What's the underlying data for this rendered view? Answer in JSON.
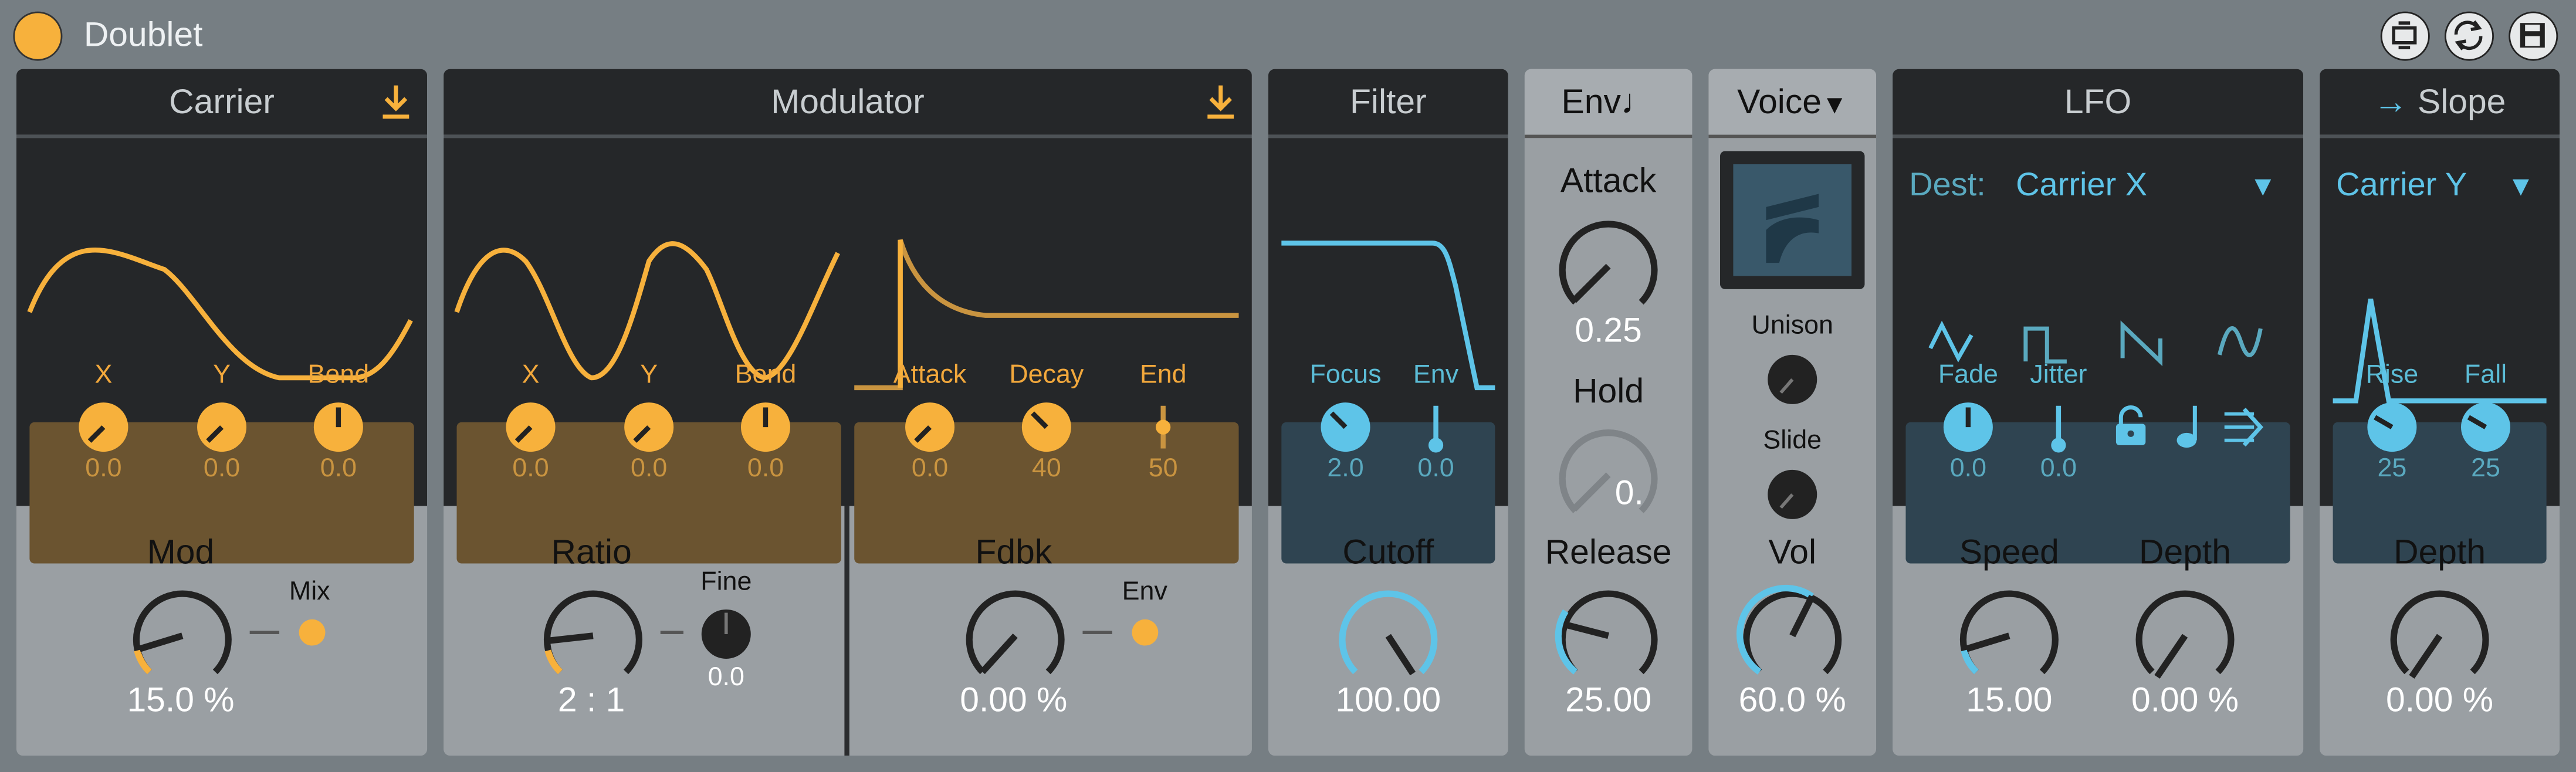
{
  "title": "Doublet",
  "colors": {
    "accent": "#f7b13c",
    "blue": "#5ec4e8",
    "panel": "#9a9fa3",
    "dark": "#252729",
    "frame": "#767e83"
  },
  "window_buttons": [
    "resize-icon",
    "refresh-icon",
    "save-icon"
  ],
  "carrier": {
    "title": "Carrier",
    "knobs": [
      {
        "label": "X",
        "value": "0.0"
      },
      {
        "label": "Y",
        "value": "0.0"
      },
      {
        "label": "Bend",
        "value": "0.0"
      }
    ],
    "mod_label": "Mod",
    "mod_value": "15.0 %",
    "mix_label": "Mix"
  },
  "modulator": {
    "title": "Modulator",
    "knobs": [
      {
        "label": "X",
        "value": "0.0"
      },
      {
        "label": "Y",
        "value": "0.0"
      },
      {
        "label": "Bend",
        "value": "0.0"
      }
    ],
    "env_knobs": [
      {
        "label": "Attack",
        "value": "0.0"
      },
      {
        "label": "Decay",
        "value": "40"
      },
      {
        "label": "End",
        "value": "50"
      }
    ],
    "ratio_label": "Ratio",
    "ratio_value": "2 : 1",
    "fine_label": "Fine",
    "fine_value": "0.0",
    "fdbk_label": "Fdbk",
    "fdbk_value": "0.00 %",
    "env_label": "Env"
  },
  "filter": {
    "title": "Filter",
    "knobs": [
      {
        "label": "Focus",
        "value": "2.0"
      },
      {
        "label": "Env",
        "value": "0.0"
      }
    ],
    "cutoff_label": "Cutoff",
    "cutoff_value": "100.00"
  },
  "env": {
    "title": "Env",
    "attack_label": "Attack",
    "attack_value": "0.25",
    "hold_label": "Hold",
    "hold_value": "0.",
    "release_label": "Release",
    "release_value": "25.00"
  },
  "voice": {
    "title": "Voice",
    "unison_label": "Unison",
    "slide_label": "Slide",
    "vol_label": "Vol",
    "vol_value": "60.0 %"
  },
  "lfo": {
    "title": "LFO",
    "dest_label": "Dest:",
    "dest_value": "Carrier X",
    "knobs": [
      {
        "label": "Fade",
        "value": "0.0"
      },
      {
        "label": "Jitter",
        "value": "0.0"
      }
    ],
    "speed_label": "Speed",
    "speed_value": "15.00",
    "depth_label": "Depth",
    "depth_value": "0.00 %"
  },
  "slope": {
    "title": "Slope",
    "target_value": "Carrier Y",
    "knobs": [
      {
        "label": "Rise",
        "value": "25"
      },
      {
        "label": "Fall",
        "value": "25"
      }
    ],
    "depth_label": "Depth",
    "depth_value": "0.00 %"
  }
}
